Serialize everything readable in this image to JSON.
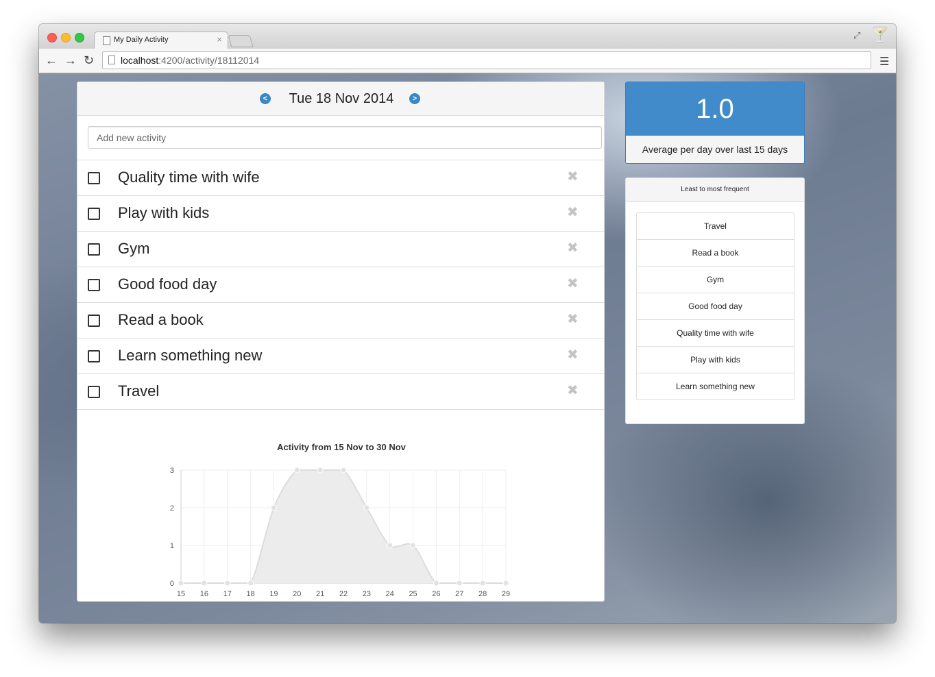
{
  "browser": {
    "tab_title": "My Daily Activity",
    "tab_close": "×",
    "url_host": "localhost",
    "url_path": ":4200/activity/18112014"
  },
  "icons": {
    "back": "arrow-left-icon",
    "forward": "arrow-right-icon",
    "reload": "reload-icon",
    "menu": "hamburger-menu-icon",
    "prev_day": "circle-arrow-left-icon",
    "next_day": "circle-arrow-right-icon",
    "remove": "close-icon",
    "extension": "cocktail-icon"
  },
  "header": {
    "date": "Tue 18 Nov 2014"
  },
  "new_activity": {
    "placeholder": "Add new activity",
    "value": ""
  },
  "activities": [
    {
      "label": "Quality time with wife",
      "checked": false
    },
    {
      "label": "Play with kids",
      "checked": false
    },
    {
      "label": "Gym",
      "checked": false
    },
    {
      "label": "Good food day",
      "checked": false
    },
    {
      "label": "Read a book",
      "checked": false
    },
    {
      "label": "Learn something new",
      "checked": false
    },
    {
      "label": "Travel",
      "checked": false
    }
  ],
  "stats": {
    "average": "1.0",
    "caption": "Average per day over last 15 days",
    "accent": "#428bca"
  },
  "frequency": {
    "header": "Least to most frequent",
    "items": [
      "Travel",
      "Read a book",
      "Gym",
      "Good food day",
      "Quality time with wife",
      "Play with kids",
      "Learn something new"
    ]
  },
  "chart_data": {
    "type": "area",
    "title": "Activity from 15 Nov to 30 Nov",
    "x": [
      15,
      16,
      17,
      18,
      19,
      20,
      21,
      22,
      23,
      24,
      25,
      26,
      27,
      28,
      29
    ],
    "series": [
      {
        "values": [
          0,
          0,
          0,
          0,
          2,
          3,
          3,
          3,
          2,
          1,
          1,
          0,
          0,
          0,
          0
        ]
      }
    ],
    "yticks": [
      0,
      1,
      2,
      3
    ],
    "ylim": [
      0,
      3
    ],
    "grid": true,
    "fill_color": "#ececec",
    "line_color": "#dcdcdc"
  }
}
